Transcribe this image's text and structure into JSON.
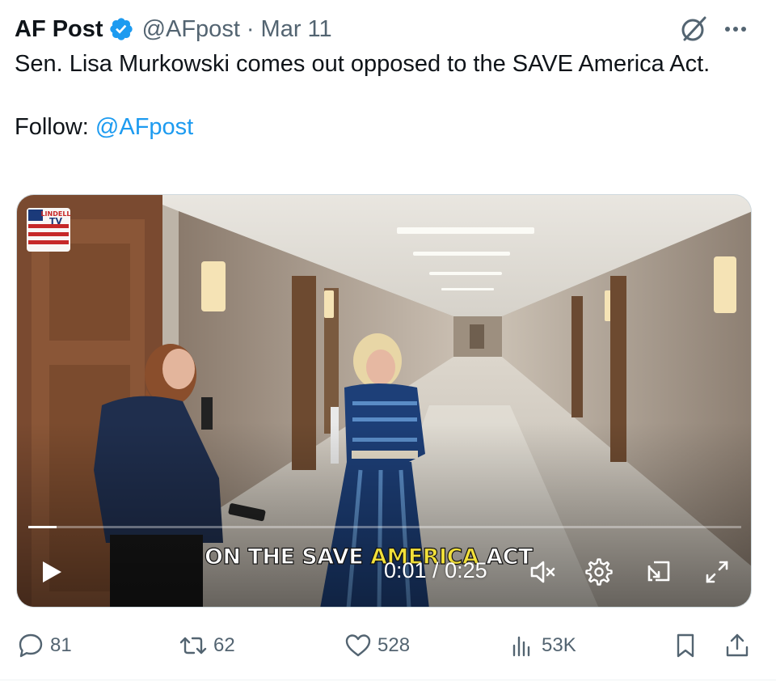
{
  "author": {
    "name": "AF Post",
    "handle": "@AFpost",
    "separator": "·",
    "date": "Mar 11",
    "verified": true,
    "verified_color": "#1d9bf0"
  },
  "tweet": {
    "text": "Sen. Lisa Murkowski comes out opposed to the SAVE America Act.",
    "follow_prefix": "Follow: ",
    "follow_mention": "@AFpost",
    "mention_color": "#1d9bf0"
  },
  "header_icons": [
    "grok-icon",
    "more-icon"
  ],
  "video": {
    "logo_text_top": "LINDELL",
    "logo_text_bottom": "TV",
    "caption_part1": "ON THE SAVE ",
    "caption_highlight": "AMERICA",
    "caption_part2": " ACT",
    "caption_highlight_color": "#f2e03a",
    "current_time": "0:01",
    "time_separator": " / ",
    "duration": "0:25",
    "progress_fraction": 0.04,
    "muted": true,
    "controls": [
      "play-icon",
      "mute-icon",
      "settings-gear-icon",
      "picture-in-picture-icon",
      "fullscreen-icon"
    ]
  },
  "actions": {
    "replies": "81",
    "reposts": "62",
    "likes": "528",
    "views": "53K"
  },
  "colors": {
    "text": "#0f1419",
    "secondary": "#536471",
    "accent": "#1d9bf0"
  }
}
